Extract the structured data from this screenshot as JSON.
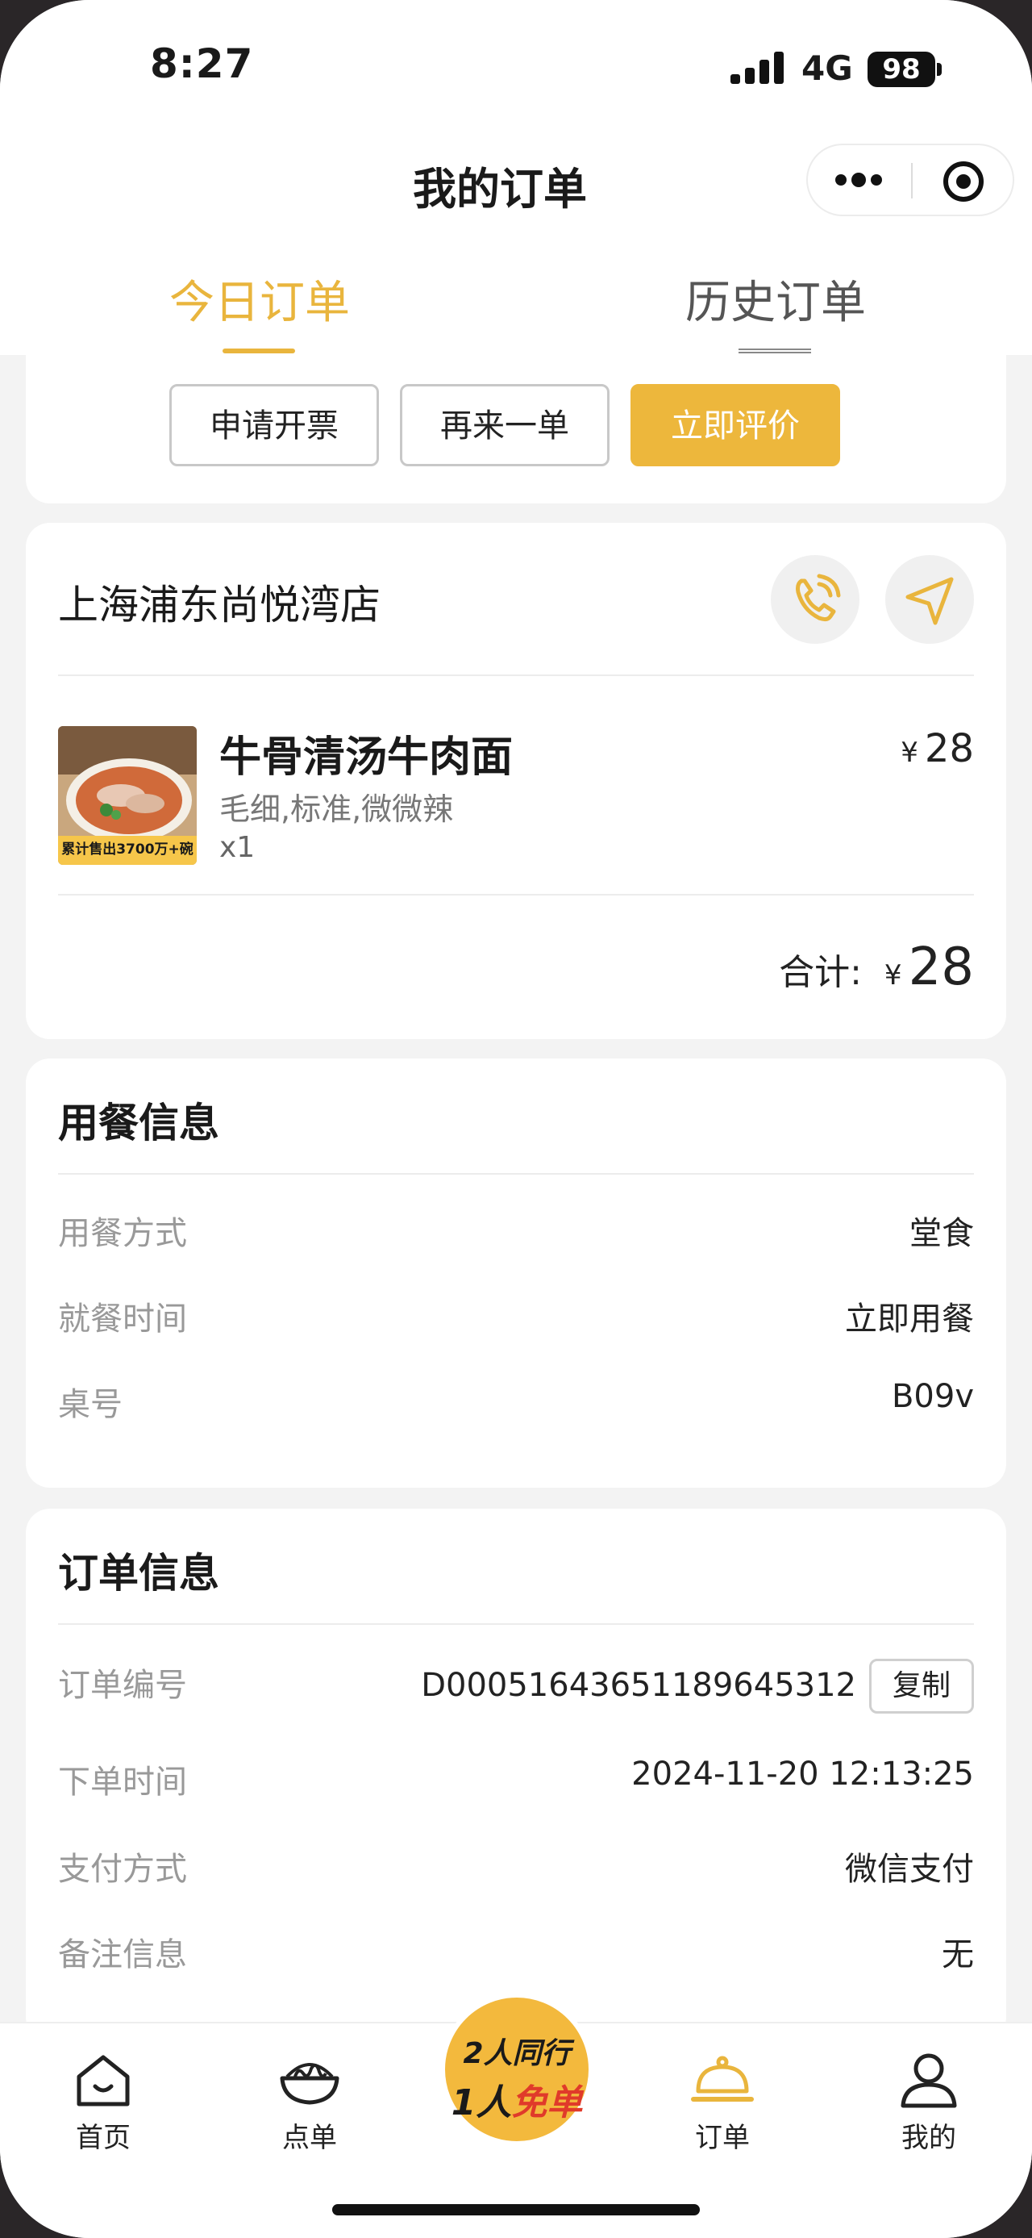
{
  "status_bar": {
    "time": "8:27",
    "network": "4G",
    "battery": "98"
  },
  "header": {
    "title": "我的订单"
  },
  "tabs": [
    {
      "label": "今日订单",
      "active": true
    },
    {
      "label": "历史订单",
      "active": false
    }
  ],
  "actions": {
    "invoice": "申请开票",
    "reorder": "再来一单",
    "review": "立即评价"
  },
  "store": {
    "name": "上海浦东尚悦湾店",
    "item": {
      "name": "牛骨清汤牛肉面",
      "spec": "毛细,标准,微微辣",
      "qty": "x1",
      "currency": "¥",
      "price": "28",
      "image_caption": "累计售出3700万+碗"
    },
    "total_label": "合计:",
    "total_currency": "¥",
    "total": "28"
  },
  "dining": {
    "title": "用餐信息",
    "rows": [
      {
        "label": "用餐方式",
        "value": "堂食"
      },
      {
        "label": "就餐时间",
        "value": "立即用餐"
      },
      {
        "label": "桌号",
        "value": "B09v"
      }
    ]
  },
  "order": {
    "title": "订单信息",
    "order_no_label": "订单编号",
    "order_no": "D0005164365118964531​2",
    "copy": "复制",
    "rows": [
      {
        "label": "下单时间",
        "value": "2024-11-20 12:13:25"
      },
      {
        "label": "支付方式",
        "value": "微信支付"
      },
      {
        "label": "备注信息",
        "value": "无"
      }
    ]
  },
  "nav": {
    "home": "首页",
    "menu": "点单",
    "orders": "订单",
    "mine": "我的",
    "promo_line1": "2人同行",
    "promo_line2a": "1人",
    "promo_line2b": "免单"
  },
  "colors": {
    "accent": "#EDB73C",
    "background": "#F3F3F3",
    "promo_red": "#E03A2A"
  }
}
